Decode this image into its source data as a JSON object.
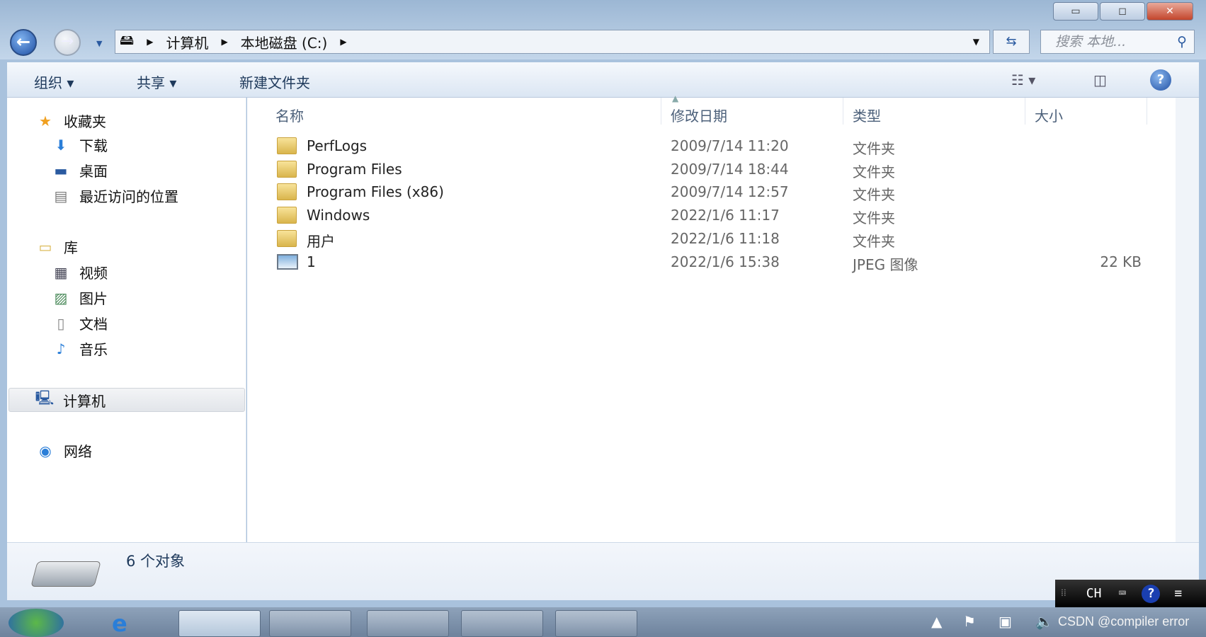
{
  "window": {
    "minimize": "▭",
    "maximize": "◻",
    "close": "✕"
  },
  "address": {
    "crumbs": [
      "计算机",
      "本地磁盘 (C:)"
    ],
    "search_placeholder": "搜索 本地..."
  },
  "toolbar": {
    "organize": "组织 ▾",
    "share": "共享 ▾",
    "new_folder": "新建文件夹",
    "help": "?"
  },
  "nav": {
    "favorites": "收藏夹",
    "downloads": "下载",
    "desktop": "桌面",
    "recent": "最近访问的位置",
    "libraries": "库",
    "videos": "视频",
    "pictures": "图片",
    "documents": "文档",
    "music": "音乐",
    "computer": "计算机",
    "network": "网络"
  },
  "columns": {
    "name": "名称",
    "date": "修改日期",
    "type": "类型",
    "size": "大小"
  },
  "files": [
    {
      "name": "PerfLogs",
      "date": "2009/7/14 11:20",
      "type": "文件夹",
      "size": "",
      "icon": "folder"
    },
    {
      "name": "Program Files",
      "date": "2009/7/14 18:44",
      "type": "文件夹",
      "size": "",
      "icon": "folder"
    },
    {
      "name": "Program Files (x86)",
      "date": "2009/7/14 12:57",
      "type": "文件夹",
      "size": "",
      "icon": "folder"
    },
    {
      "name": "Windows",
      "date": "2022/1/6 11:17",
      "type": "文件夹",
      "size": "",
      "icon": "folder"
    },
    {
      "name": "用户",
      "date": "2022/1/6 11:18",
      "type": "文件夹",
      "size": "",
      "icon": "folder"
    },
    {
      "name": "1",
      "date": "2022/1/6 15:38",
      "type": "JPEG 图像",
      "size": "22 KB",
      "icon": "jpeg"
    }
  ],
  "status": {
    "count": "6 个对象"
  },
  "langbar": {
    "lang": "CH",
    "help": "?"
  },
  "watermark": "CSDN @compiler error"
}
